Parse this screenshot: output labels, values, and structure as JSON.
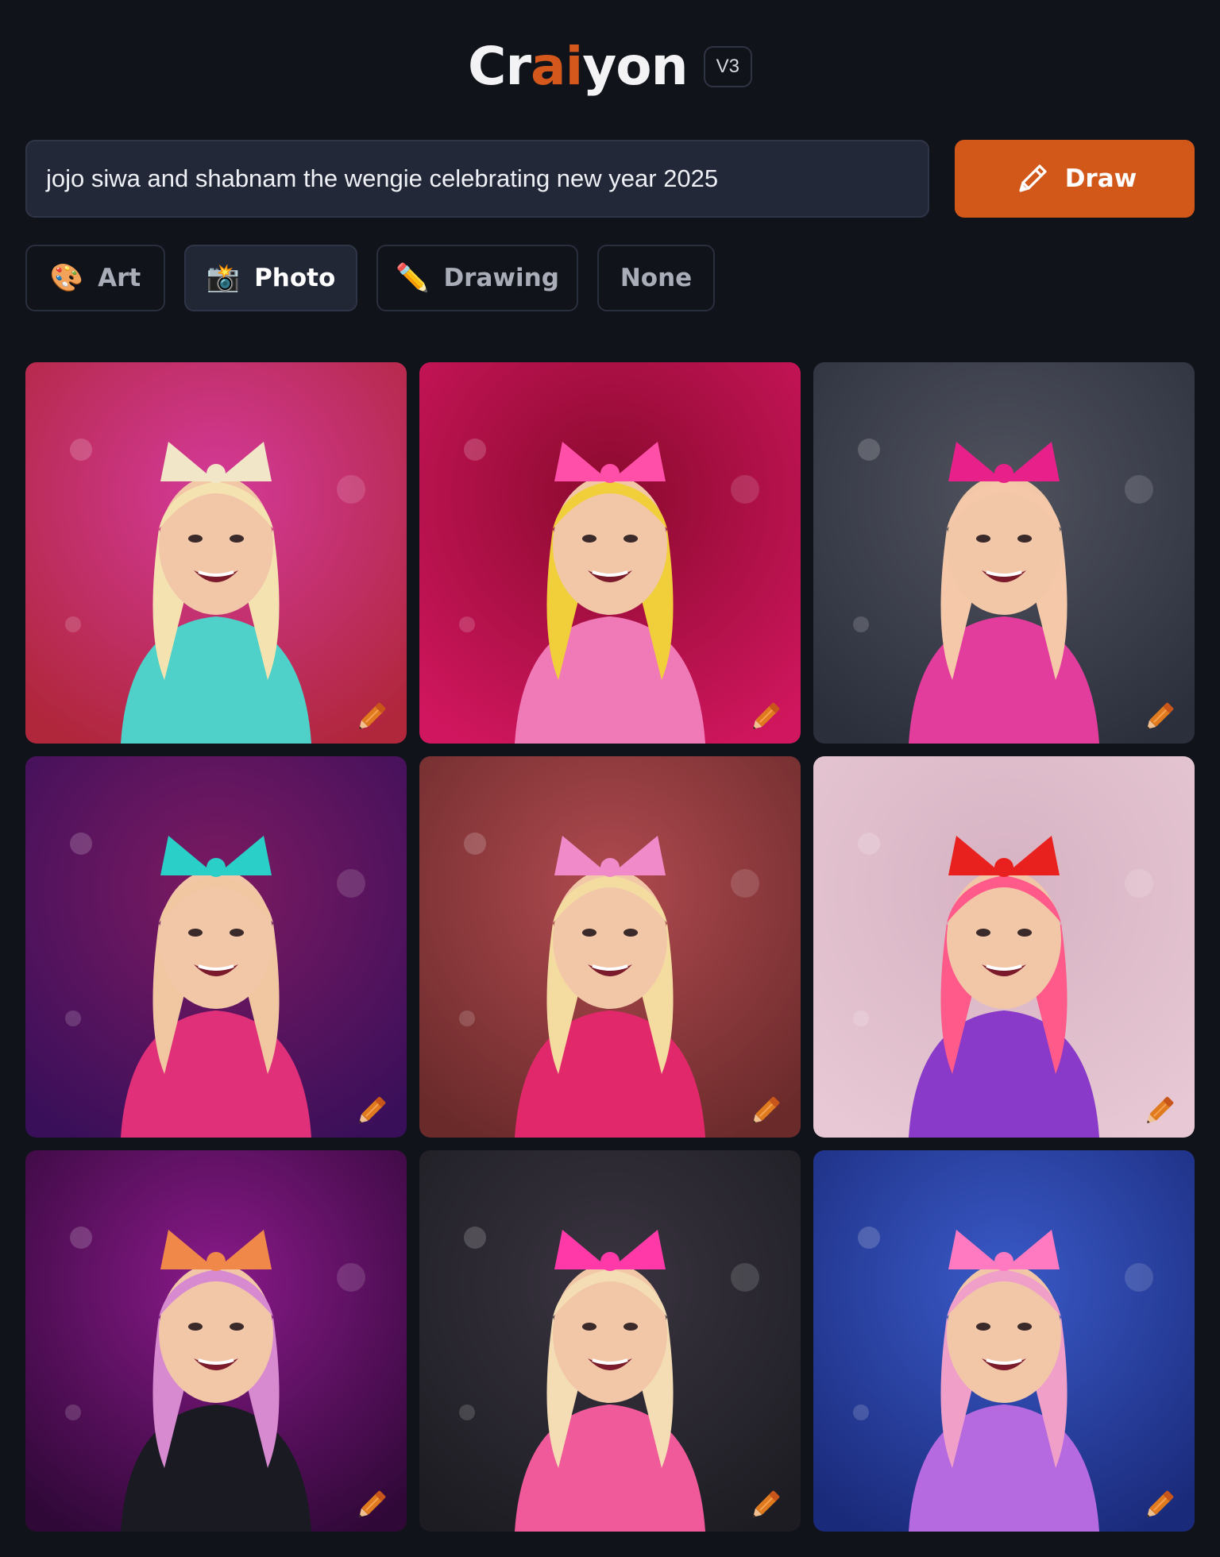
{
  "app": {
    "logo_parts": [
      "Cr",
      "ai",
      "yon"
    ],
    "version": "V3",
    "accent_color": "#d2581a"
  },
  "prompt": {
    "value": "jojo siwa and shabnam the wengie celebrating new year 2025"
  },
  "draw_button": {
    "label": "Draw",
    "icon": "pencil-icon"
  },
  "styles": [
    {
      "id": "art",
      "label": "Art",
      "icon": "🎨",
      "selected": false
    },
    {
      "id": "photo",
      "label": "Photo",
      "icon": "📸",
      "selected": true
    },
    {
      "id": "drawing",
      "label": "Drawing",
      "icon": "✏️",
      "selected": false
    },
    {
      "id": "none",
      "label": "None",
      "icon": "",
      "selected": false
    }
  ],
  "images": [
    {
      "bg1": "#b0263a",
      "bg2": "#d43a9a",
      "hair": "#f4e2b0",
      "outfit": "#4fd0c8",
      "bow": "#f2e6c8"
    },
    {
      "bg1": "#d0165e",
      "bg2": "#8a0a2e",
      "hair": "#f1cf3a",
      "outfit": "#f07ab8",
      "bow": "#ff4fa8"
    },
    {
      "bg1": "#2b2f3c",
      "bg2": "#50535e",
      "hair": "#f4c8a8",
      "outfit": "#e23c9c",
      "bow": "#e8208a"
    },
    {
      "bg1": "#3a0f5a",
      "bg2": "#7c1a62",
      "hair": "#f0c7a0",
      "outfit": "#e0307a",
      "bow": "#2ad0c8"
    },
    {
      "bg1": "#6a2a2a",
      "bg2": "#b04a50",
      "hair": "#f4dca0",
      "outfit": "#e0286a",
      "bow": "#f08ac8"
    },
    {
      "bg1": "#e8c8d4",
      "bg2": "#d6b2c2",
      "hair": "#ff5a8a",
      "outfit": "#8a3ac8",
      "bow": "#e8201e"
    },
    {
      "bg1": "#300838",
      "bg2": "#8a1a8a",
      "hair": "#d88ad0",
      "outfit": "#1a1a22",
      "bow": "#f0884a"
    },
    {
      "bg1": "#1c1c22",
      "bg2": "#3a3440",
      "hair": "#f4dcb4",
      "outfit": "#f05a9a",
      "bow": "#ff3aa8"
    },
    {
      "bg1": "#1a2a7a",
      "bg2": "#3a5ac8",
      "hair": "#f0a0c8",
      "outfit": "#b66ae0",
      "bow": "#ff7ac0"
    }
  ]
}
